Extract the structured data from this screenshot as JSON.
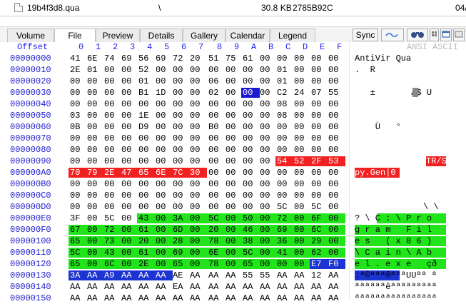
{
  "titlebar": {
    "filename": "19b4f3d8.qua",
    "path": "\\",
    "size": "30.8 KB",
    "crc": "2785B92C",
    "date": "04/"
  },
  "tabs": [
    "Volume",
    "File",
    "Preview",
    "Details",
    "Gallery",
    "Calendar",
    "Legend"
  ],
  "active_tab": "File",
  "toolbar": {
    "sync_label": "Sync"
  },
  "icons": [
    "wave-icon",
    "binoculars-icon",
    "grid-icon",
    "windows-icon"
  ],
  "hex_header": {
    "offset_label": "Offset",
    "columns": [
      "0",
      "1",
      "2",
      "3",
      "4",
      "5",
      "6",
      "7",
      "8",
      "9",
      "A",
      "B",
      "C",
      "D",
      "E",
      "F"
    ],
    "encoding_label": "ANSI ASCII"
  },
  "rows": [
    {
      "offset": "00000000",
      "bytes": [
        "41",
        "6E",
        "74",
        "69",
        "56",
        "69",
        "72",
        "20",
        "51",
        "75",
        "61",
        "00",
        "00",
        "00",
        "00",
        "00"
      ],
      "text": "AntiVir Qua"
    },
    {
      "offset": "00000010",
      "bytes": [
        "2E",
        "01",
        "00",
        "00",
        "52",
        "00",
        "00",
        "00",
        "00",
        "00",
        "00",
        "00",
        "01",
        "00",
        "00",
        "00"
      ],
      "text": ".  R"
    },
    {
      "offset": "00000020",
      "bytes": [
        "00",
        "00",
        "00",
        "00",
        "01",
        "00",
        "00",
        "00",
        "06",
        "00",
        "00",
        "00",
        "01",
        "00",
        "00",
        "00"
      ],
      "text": ""
    },
    {
      "offset": "00000030",
      "bytes": [
        "00",
        "00",
        "00",
        "00",
        "B1",
        "1D",
        "00",
        "00",
        "02",
        "00",
        "00",
        "00",
        "C2",
        "24",
        "07",
        "55"
      ],
      "text": "   ±       Â$ U"
    },
    {
      "offset": "00000040",
      "bytes": [
        "00",
        "00",
        "00",
        "00",
        "00",
        "00",
        "00",
        "00",
        "00",
        "00",
        "00",
        "00",
        "08",
        "00",
        "00",
        "00"
      ],
      "text": ""
    },
    {
      "offset": "00000050",
      "bytes": [
        "03",
        "00",
        "00",
        "00",
        "1E",
        "00",
        "00",
        "00",
        "00",
        "00",
        "00",
        "00",
        "08",
        "00",
        "00",
        "00"
      ],
      "text": ""
    },
    {
      "offset": "00000060",
      "bytes": [
        "0B",
        "00",
        "00",
        "00",
        "D9",
        "00",
        "00",
        "00",
        "B0",
        "00",
        "00",
        "00",
        "00",
        "00",
        "00",
        "00"
      ],
      "text": "    Ù   °"
    },
    {
      "offset": "00000070",
      "bytes": [
        "00",
        "00",
        "00",
        "00",
        "00",
        "00",
        "00",
        "00",
        "00",
        "00",
        "00",
        "00",
        "00",
        "00",
        "00",
        "00"
      ],
      "text": ""
    },
    {
      "offset": "00000080",
      "bytes": [
        "00",
        "00",
        "00",
        "00",
        "00",
        "00",
        "00",
        "00",
        "00",
        "00",
        "00",
        "00",
        "00",
        "00",
        "00",
        "00"
      ],
      "text": ""
    },
    {
      "offset": "00000090",
      "bytes": [
        "00",
        "00",
        "00",
        "00",
        "00",
        "00",
        "00",
        "00",
        "00",
        "00",
        "00",
        "00",
        "54",
        "52",
        "2F",
        "53"
      ],
      "text": "TR/S"
    },
    {
      "offset": "000000A0",
      "bytes": [
        "70",
        "79",
        "2E",
        "47",
        "65",
        "6E",
        "7C",
        "30",
        "00",
        "00",
        "00",
        "00",
        "00",
        "00",
        "00",
        "00"
      ],
      "text": "py.Gen|0"
    },
    {
      "offset": "000000B0",
      "bytes": [
        "00",
        "00",
        "00",
        "00",
        "00",
        "00",
        "00",
        "00",
        "00",
        "00",
        "00",
        "00",
        "00",
        "00",
        "00",
        "00"
      ],
      "text": ""
    },
    {
      "offset": "000000C0",
      "bytes": [
        "00",
        "00",
        "00",
        "00",
        "00",
        "00",
        "00",
        "00",
        "00",
        "00",
        "00",
        "00",
        "00",
        "00",
        "00",
        "00"
      ],
      "text": ""
    },
    {
      "offset": "000000D0",
      "bytes": [
        "00",
        "00",
        "00",
        "00",
        "00",
        "00",
        "00",
        "00",
        "00",
        "00",
        "00",
        "00",
        "5C",
        "00",
        "5C",
        "00"
      ],
      "text": "\\ \\"
    },
    {
      "offset": "000000E0",
      "bytes": [
        "3F",
        "00",
        "5C",
        "00",
        "43",
        "00",
        "3A",
        "00",
        "5C",
        "00",
        "50",
        "00",
        "72",
        "00",
        "6F",
        "00"
      ],
      "text": "? \\ C : \\ P r o"
    },
    {
      "offset": "000000F0",
      "bytes": [
        "67",
        "00",
        "72",
        "00",
        "61",
        "00",
        "6D",
        "00",
        "20",
        "00",
        "46",
        "00",
        "69",
        "00",
        "6C",
        "00"
      ],
      "text": "g r a m   F i l"
    },
    {
      "offset": "00000100",
      "bytes": [
        "65",
        "00",
        "73",
        "00",
        "20",
        "00",
        "28",
        "00",
        "78",
        "00",
        "38",
        "00",
        "36",
        "00",
        "29",
        "00"
      ],
      "text": "e s   ( x 8 6 )"
    },
    {
      "offset": "00000110",
      "bytes": [
        "5C",
        "00",
        "43",
        "00",
        "61",
        "00",
        "69",
        "00",
        "6E",
        "00",
        "5C",
        "00",
        "41",
        "00",
        "62",
        "00"
      ],
      "text": "\\ C a i n \\ A b"
    },
    {
      "offset": "00000120",
      "bytes": [
        "65",
        "00",
        "6C",
        "00",
        "2E",
        "00",
        "65",
        "00",
        "78",
        "00",
        "65",
        "00",
        "00",
        "00",
        "E7",
        "F0"
      ],
      "text": "e l . e x e   çð"
    },
    {
      "offset": "00000130",
      "bytes": [
        "3A",
        "AA",
        "A9",
        "AA",
        "AA",
        "AA",
        "AE",
        "AA",
        "AA",
        "AA",
        "55",
        "55",
        "AA",
        "AA",
        "12",
        "AA"
      ],
      "text": ":ª©ªªª®ªªªUUªª ª"
    },
    {
      "offset": "00000140",
      "bytes": [
        "AA",
        "AA",
        "AA",
        "AA",
        "AA",
        "AA",
        "EA",
        "AA",
        "AA",
        "AA",
        "AA",
        "AA",
        "AA",
        "AA",
        "AA",
        "AA"
      ],
      "text": "ªªªªªªêªªªªªªªªª"
    },
    {
      "offset": "00000150",
      "bytes": [
        "AA",
        "AA",
        "AA",
        "AA",
        "AA",
        "AA",
        "AA",
        "AA",
        "AA",
        "AA",
        "AA",
        "AA",
        "AA",
        "AA",
        "AA",
        "AA"
      ],
      "text": "ªªªªªªªªªªªªªªªª"
    }
  ]
}
